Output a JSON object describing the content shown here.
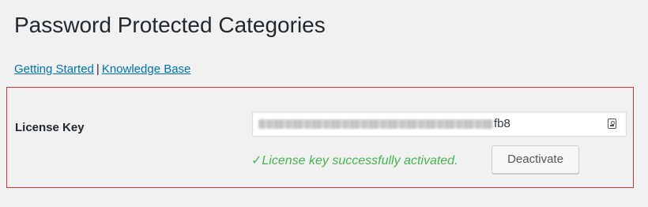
{
  "page": {
    "title": "Password Protected Categories"
  },
  "links": {
    "getting_started": "Getting Started",
    "separator": "|",
    "knowledge_base": "Knowledge Base"
  },
  "license": {
    "label": "License Key",
    "value_visible_suffix": "fb8",
    "icon": "contact-card-icon",
    "status": "✓License key successfully activated.",
    "deactivate_label": "Deactivate"
  },
  "colors": {
    "link": "#0073aa",
    "success": "#46b450",
    "highlight_border": "#dc3232",
    "background": "#f1f1f1"
  }
}
